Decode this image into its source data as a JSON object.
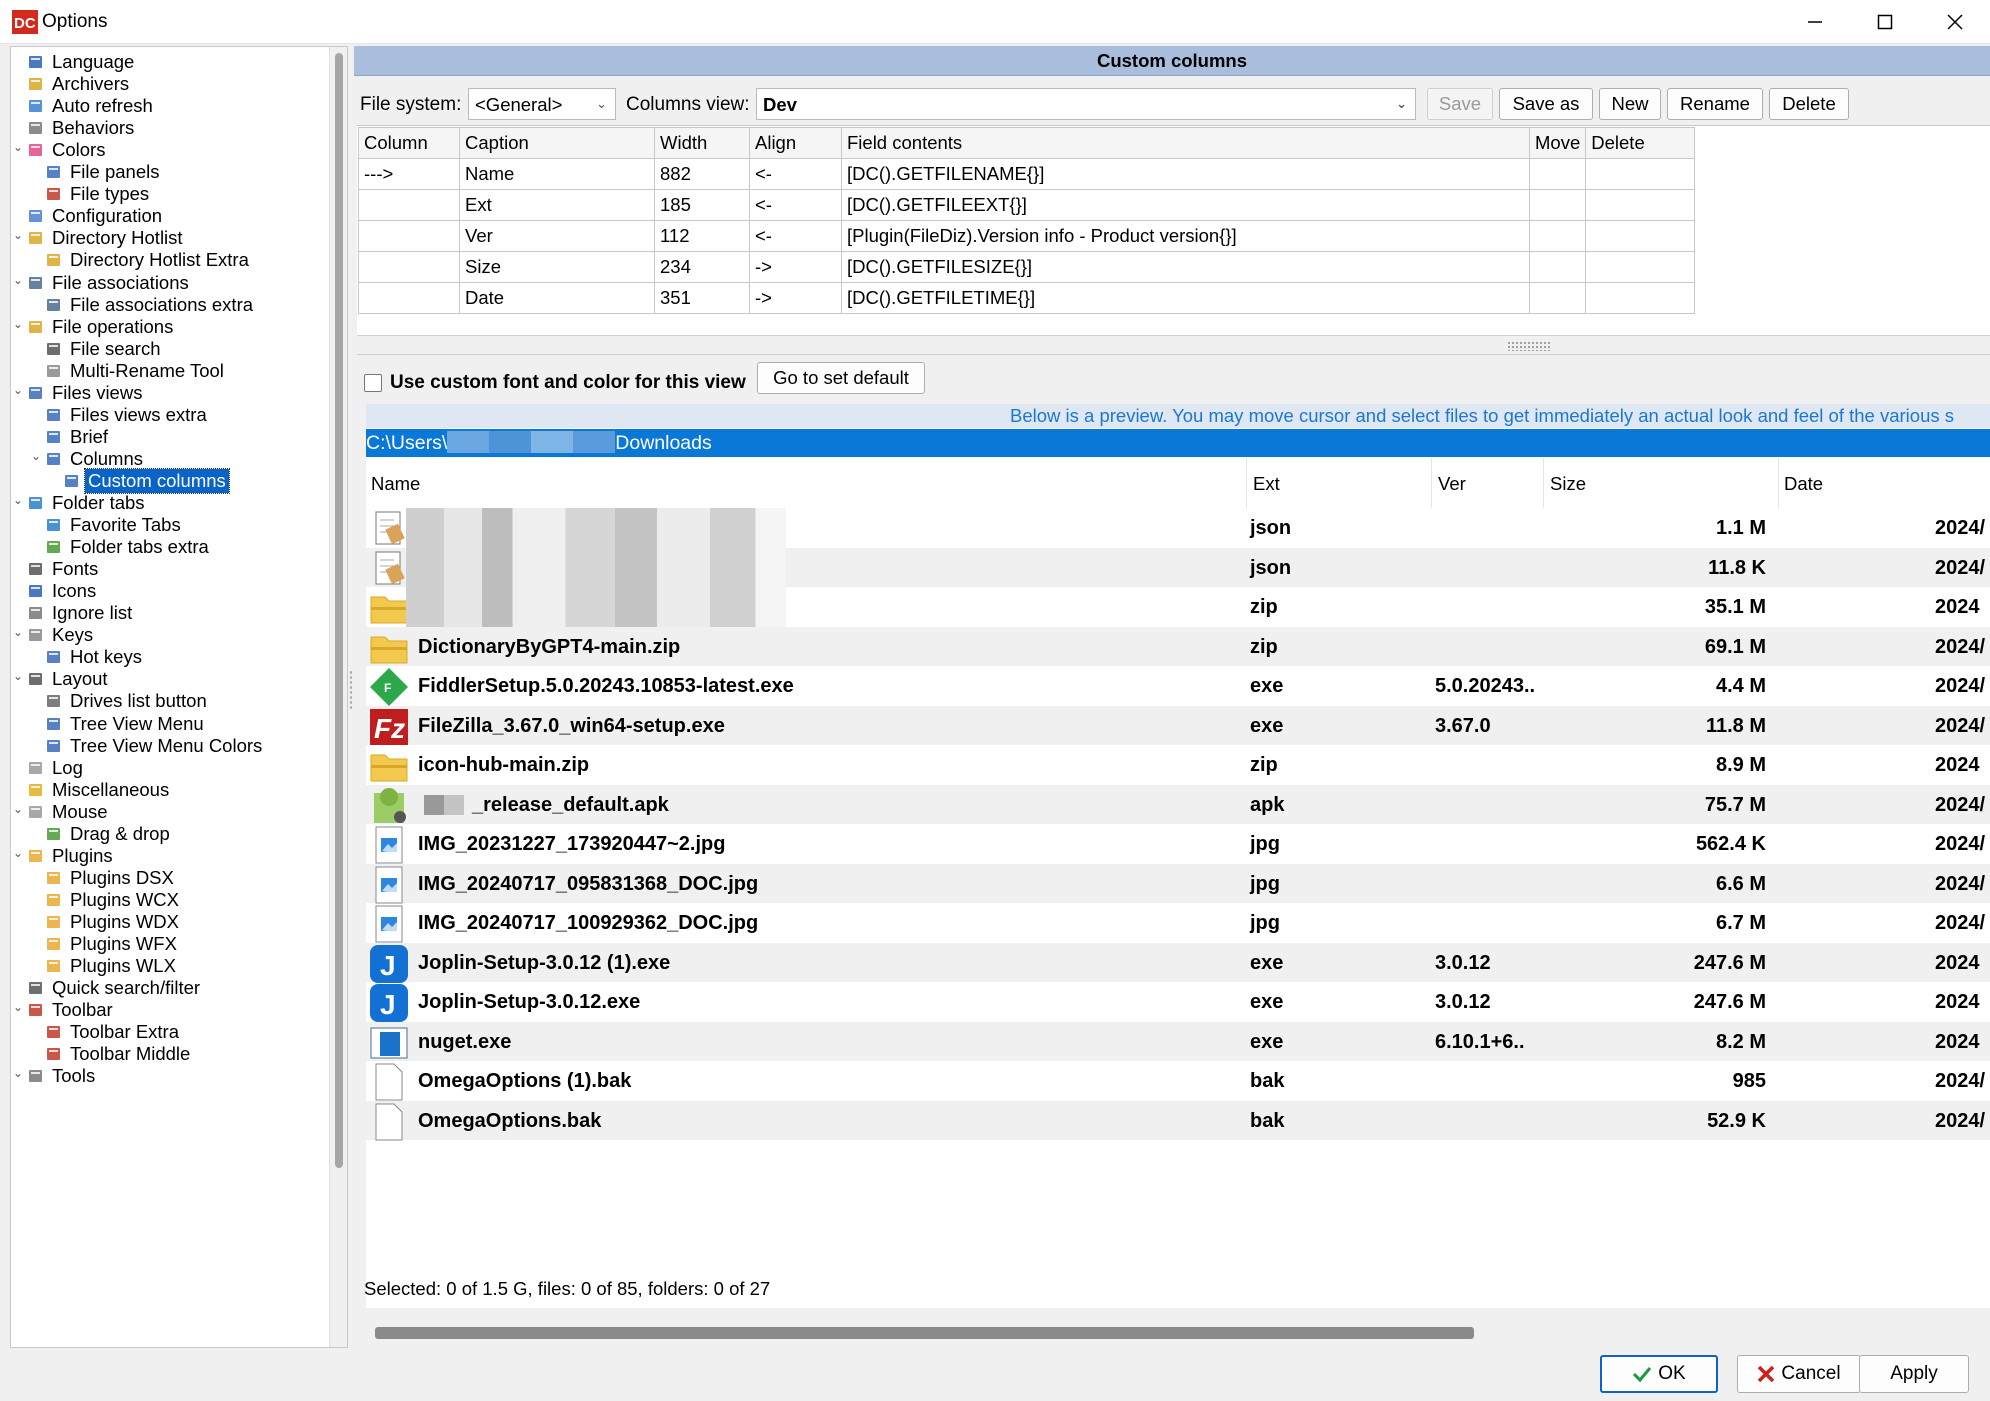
{
  "window": {
    "title": "Options",
    "controls": [
      "minimize",
      "maximize",
      "close"
    ]
  },
  "tree": {
    "items": [
      {
        "label": "Language",
        "icon": "language-icon"
      },
      {
        "label": "Archivers",
        "icon": "archive-icon"
      },
      {
        "label": "Auto refresh",
        "icon": "refresh-icon"
      },
      {
        "label": "Behaviors",
        "icon": "behaviors-icon"
      },
      {
        "label": "Colors",
        "icon": "color-wheel-icon"
      },
      {
        "label": "File panels",
        "icon": "panels-icon"
      },
      {
        "label": "File types",
        "icon": "file-types-icon"
      },
      {
        "label": "Configuration",
        "icon": "config-icon"
      },
      {
        "label": "Directory Hotlist",
        "icon": "folder-star-icon"
      },
      {
        "label": "Directory Hotlist Extra",
        "icon": "folder-star-icon"
      },
      {
        "label": "File associations",
        "icon": "file-assoc-icon"
      },
      {
        "label": "File associations extra",
        "icon": "file-assoc-icon"
      },
      {
        "label": "File operations",
        "icon": "file-ops-icon"
      },
      {
        "label": "File search",
        "icon": "binoculars-icon"
      },
      {
        "label": "Multi-Rename Tool",
        "icon": "rename-icon"
      },
      {
        "label": "Files views",
        "icon": "files-views-icon"
      },
      {
        "label": "Files views extra",
        "icon": "files-views-icon"
      },
      {
        "label": "Brief",
        "icon": "brief-icon"
      },
      {
        "label": "Columns",
        "icon": "columns-icon"
      },
      {
        "label": "Custom columns",
        "icon": "custom-columns-icon"
      },
      {
        "label": "Folder tabs",
        "icon": "folder-tabs-icon"
      },
      {
        "label": "Favorite Tabs",
        "icon": "favorite-tabs-icon"
      },
      {
        "label": "Folder tabs extra",
        "icon": "folder-tabs-extra-icon"
      },
      {
        "label": "Fonts",
        "icon": "fonts-icon"
      },
      {
        "label": "Icons",
        "icon": "icons-icon"
      },
      {
        "label": "Ignore list",
        "icon": "ignore-icon"
      },
      {
        "label": "Keys",
        "icon": "keys-icon"
      },
      {
        "label": "Hot keys",
        "icon": "hotkeys-icon"
      },
      {
        "label": "Layout",
        "icon": "layout-icon"
      },
      {
        "label": "Drives list button",
        "icon": "drives-icon"
      },
      {
        "label": "Tree View Menu",
        "icon": "tree-menu-icon"
      },
      {
        "label": "Tree View Menu Colors",
        "icon": "tree-menu-icon"
      },
      {
        "label": "Log",
        "icon": "log-icon"
      },
      {
        "label": "Miscellaneous",
        "icon": "misc-icon"
      },
      {
        "label": "Mouse",
        "icon": "mouse-icon"
      },
      {
        "label": "Drag & drop",
        "icon": "drag-drop-icon"
      },
      {
        "label": "Plugins",
        "icon": "plugin-icon"
      },
      {
        "label": "Plugins DSX",
        "icon": "plugin-icon"
      },
      {
        "label": "Plugins WCX",
        "icon": "plugin-icon"
      },
      {
        "label": "Plugins WDX",
        "icon": "plugin-icon"
      },
      {
        "label": "Plugins WFX",
        "icon": "plugin-icon"
      },
      {
        "label": "Plugins WLX",
        "icon": "plugin-icon"
      },
      {
        "label": "Quick search/filter",
        "icon": "quick-search-icon"
      },
      {
        "label": "Toolbar",
        "icon": "toolbar-icon"
      },
      {
        "label": "Toolbar Extra",
        "icon": "toolbar-icon"
      },
      {
        "label": "Toolbar Middle",
        "icon": "toolbar-icon"
      },
      {
        "label": "Tools",
        "icon": "tools-icon"
      }
    ]
  },
  "panel": {
    "title": "Custom columns",
    "file_system_label": "File system:",
    "file_system_value": "<General>",
    "columns_view_label": "Columns view:",
    "columns_view_value": "Dev",
    "buttons": {
      "save": "Save",
      "save_as": "Save as",
      "new": "New",
      "rename": "Rename",
      "delete": "Delete"
    },
    "grid": {
      "headers": [
        "Column",
        "Caption",
        "Width",
        "Align",
        "Field contents",
        "Move",
        "Delete"
      ],
      "rows": [
        [
          "--->",
          "Name",
          "882",
          "<-",
          "[DC().GETFILENAME{}]",
          "",
          ""
        ],
        [
          "",
          "Ext",
          "185",
          "<-",
          "[DC().GETFILEEXT{}]",
          "",
          ""
        ],
        [
          "",
          "Ver",
          "112",
          "<-",
          "[Plugin(FileDiz).Version info - Product version{}]",
          "",
          ""
        ],
        [
          "",
          "Size",
          "234",
          "->",
          "[DC().GETFILESIZE{}]",
          "",
          ""
        ],
        [
          "",
          "Date",
          "351",
          "->",
          "[DC().GETFILETIME{}]",
          "",
          ""
        ]
      ]
    },
    "custom_font_label": "Use custom font and color for this view",
    "go_default_label": "Go to set default"
  },
  "preview": {
    "info": "Below is a preview. You may move cursor and select files to get immediately an actual look and feel of the various s",
    "path_prefix": "C:\\Users\\",
    "path_suffix": "Downloads",
    "headers": {
      "name": "Name",
      "ext": "Ext",
      "ver": "Ver",
      "size": "Size",
      "date": "Date"
    },
    "files": [
      {
        "name": "",
        "ext": "json",
        "ver": "",
        "size": "1.1 M",
        "date": "2024/",
        "icon": "json-file-icon"
      },
      {
        "name": "",
        "ext": "json",
        "ver": "",
        "size": "11.8 K",
        "date": "2024/",
        "icon": "json-file-icon"
      },
      {
        "name": "",
        "ext": "zip",
        "ver": "",
        "size": "35.1 M",
        "date": "2024",
        "icon": "zip-folder-icon"
      },
      {
        "name": "DictionaryByGPT4-main.zip",
        "ext": "zip",
        "ver": "",
        "size": "69.1 M",
        "date": "2024/",
        "icon": "zip-folder-icon"
      },
      {
        "name": "FiddlerSetup.5.0.20243.10853-latest.exe",
        "ext": "exe",
        "ver": "5.0.20243..",
        "size": "4.4 M",
        "date": "2024/",
        "icon": "fiddler-icon"
      },
      {
        "name": "FileZilla_3.67.0_win64-setup.exe",
        "ext": "exe",
        "ver": "3.67.0",
        "size": "11.8 M",
        "date": "2024/",
        "icon": "filezilla-icon"
      },
      {
        "name": "icon-hub-main.zip",
        "ext": "zip",
        "ver": "",
        "size": "8.9 M",
        "date": "2024",
        "icon": "zip-folder-icon"
      },
      {
        "name": "_release_default.apk",
        "ext": "apk",
        "ver": "",
        "size": "75.7 M",
        "date": "2024/",
        "icon": "android-apk-icon"
      },
      {
        "name": "IMG_20231227_173920447~2.jpg",
        "ext": "jpg",
        "ver": "",
        "size": "562.4 K",
        "date": "2024/",
        "icon": "image-file-icon"
      },
      {
        "name": "IMG_20240717_095831368_DOC.jpg",
        "ext": "jpg",
        "ver": "",
        "size": "6.6 M",
        "date": "2024/",
        "icon": "image-file-icon"
      },
      {
        "name": "IMG_20240717_100929362_DOC.jpg",
        "ext": "jpg",
        "ver": "",
        "size": "6.7 M",
        "date": "2024/",
        "icon": "image-file-icon"
      },
      {
        "name": "Joplin-Setup-3.0.12 (1).exe",
        "ext": "exe",
        "ver": "3.0.12",
        "size": "247.6 M",
        "date": "2024",
        "icon": "joplin-icon"
      },
      {
        "name": "Joplin-Setup-3.0.12.exe",
        "ext": "exe",
        "ver": "3.0.12",
        "size": "247.6 M",
        "date": "2024",
        "icon": "joplin-icon"
      },
      {
        "name": "nuget.exe",
        "ext": "exe",
        "ver": "6.10.1+6..",
        "size": "8.2 M",
        "date": "2024",
        "icon": "exe-window-icon"
      },
      {
        "name": "OmegaOptions (1).bak",
        "ext": "bak",
        "ver": "",
        "size": "985",
        "date": "2024/",
        "icon": "blank-file-icon"
      },
      {
        "name": "OmegaOptions.bak",
        "ext": "bak",
        "ver": "",
        "size": "52.9 K",
        "date": "2024/",
        "icon": "blank-file-icon"
      }
    ],
    "status": "Selected: 0 of 1.5 G, files: 0 of 85, folders: 0 of 27"
  },
  "footer": {
    "ok": "OK",
    "cancel": "Cancel",
    "apply": "Apply"
  },
  "colors": {
    "selection": "#0a64c8",
    "header": "#a9bedc",
    "path_bar": "#0a78d7",
    "info_text": "#1a77d2"
  }
}
